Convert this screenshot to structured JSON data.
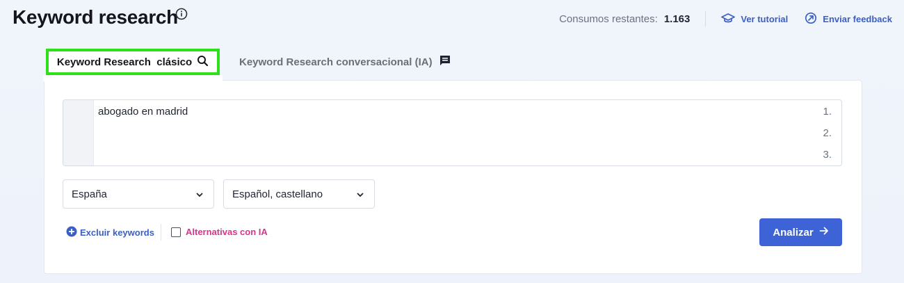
{
  "header": {
    "title": "Keyword research",
    "info_icon": "info-icon",
    "consumos_label": "Consumos restantes:",
    "consumos_value": "1.163",
    "tutorial_label": "Ver tutorial",
    "feedback_label": "Enviar feedback"
  },
  "tabs": [
    {
      "label": "Keyword Research  clásico",
      "icon": "search-icon",
      "active": true
    },
    {
      "label": "Keyword Research conversacional (IA)",
      "icon": "chat-icon",
      "active": false
    }
  ],
  "editor": {
    "lines": [
      {
        "num": "1.",
        "text": "abogado en madrid"
      },
      {
        "num": "2.",
        "text": ""
      },
      {
        "num": "3.",
        "text": ""
      }
    ]
  },
  "filters": {
    "country": "España",
    "language": "Español, castellano"
  },
  "actions": {
    "exclude_label": "Excluir keywords",
    "alternatives_label": "Alternativas con IA",
    "analyze_label": "Analizar"
  },
  "colors": {
    "accent": "#3d63d6",
    "link": "#3b5fc4",
    "highlight": "#2ee01a",
    "ai_pink": "#d9348a"
  }
}
